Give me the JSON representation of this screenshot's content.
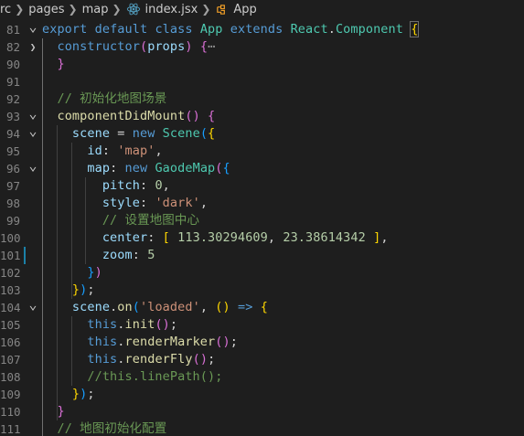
{
  "breadcrumb": {
    "items": [
      {
        "label": "rc"
      },
      {
        "label": "pages"
      },
      {
        "label": "map"
      },
      {
        "label": "index.jsx",
        "icon": "react-icon"
      },
      {
        "label": "App",
        "icon": "class-icon"
      }
    ]
  },
  "colors": {
    "background": "#1e1e1e",
    "keyword": "#569cd6",
    "class": "#4ec9b0",
    "function": "#dcdcaa",
    "variable": "#9cdcfe",
    "string": "#ce9178",
    "number": "#b5cea8",
    "comment": "#6a9955",
    "modified_bar": "#1b81a8"
  },
  "lines": [
    {
      "n": "81",
      "fold": "chevron-down",
      "tokens": [
        [
          "kw",
          "export"
        ],
        [
          "punc",
          " "
        ],
        [
          "kw",
          "default"
        ],
        [
          "punc",
          " "
        ],
        [
          "kw",
          "class"
        ],
        [
          "punc",
          " "
        ],
        [
          "cls",
          "App"
        ],
        [
          "punc",
          " "
        ],
        [
          "kw",
          "extends"
        ],
        [
          "punc",
          " "
        ],
        [
          "cls",
          "React"
        ],
        [
          "punc",
          "."
        ],
        [
          "cls",
          "Component"
        ],
        [
          "punc",
          " "
        ],
        [
          "b1box",
          "{"
        ]
      ]
    },
    {
      "n": "82",
      "fold": "chevron-right",
      "tokens": [
        [
          "punc",
          "  "
        ],
        [
          "kw",
          "constructor"
        ],
        [
          "b2",
          "("
        ],
        [
          "var",
          "props"
        ],
        [
          "b2",
          ")"
        ],
        [
          "punc",
          " "
        ],
        [
          "b2",
          "{"
        ],
        [
          "ell",
          "⋯"
        ]
      ]
    },
    {
      "n": "90",
      "fold": "",
      "tokens": [
        [
          "punc",
          "  "
        ],
        [
          "b2",
          "}"
        ]
      ]
    },
    {
      "n": "91",
      "fold": "",
      "tokens": []
    },
    {
      "n": "92",
      "fold": "",
      "tokens": [
        [
          "punc",
          "  "
        ],
        [
          "cmt",
          "// 初始化地图场景"
        ]
      ]
    },
    {
      "n": "93",
      "fold": "chevron-down",
      "tokens": [
        [
          "punc",
          "  "
        ],
        [
          "fn",
          "componentDidMount"
        ],
        [
          "b2",
          "()"
        ],
        [
          "punc",
          " "
        ],
        [
          "b2",
          "{"
        ]
      ]
    },
    {
      "n": "94",
      "fold": "chevron-down",
      "tokens": [
        [
          "punc",
          "    "
        ],
        [
          "var",
          "scene"
        ],
        [
          "punc",
          " = "
        ],
        [
          "kw",
          "new"
        ],
        [
          "punc",
          " "
        ],
        [
          "cls",
          "Scene"
        ],
        [
          "b3",
          "("
        ],
        [
          "b1",
          "{"
        ]
      ]
    },
    {
      "n": "95",
      "fold": "",
      "tokens": [
        [
          "punc",
          "      "
        ],
        [
          "var",
          "id"
        ],
        [
          "punc",
          ": "
        ],
        [
          "str",
          "'map'"
        ],
        [
          "punc",
          ","
        ]
      ]
    },
    {
      "n": "96",
      "fold": "chevron-down",
      "tokens": [
        [
          "punc",
          "      "
        ],
        [
          "var",
          "map"
        ],
        [
          "punc",
          ": "
        ],
        [
          "kw",
          "new"
        ],
        [
          "punc",
          " "
        ],
        [
          "cls",
          "GaodeMap"
        ],
        [
          "b2",
          "("
        ],
        [
          "b3",
          "{"
        ]
      ]
    },
    {
      "n": "97",
      "fold": "",
      "tokens": [
        [
          "punc",
          "        "
        ],
        [
          "var",
          "pitch"
        ],
        [
          "punc",
          ": "
        ],
        [
          "num",
          "0"
        ],
        [
          "punc",
          ","
        ]
      ]
    },
    {
      "n": "98",
      "fold": "",
      "tokens": [
        [
          "punc",
          "        "
        ],
        [
          "var",
          "style"
        ],
        [
          "punc",
          ": "
        ],
        [
          "str",
          "'dark'"
        ],
        [
          "punc",
          ","
        ]
      ]
    },
    {
      "n": "99",
      "fold": "",
      "tokens": [
        [
          "punc",
          "        "
        ],
        [
          "cmt",
          "// 设置地图中心"
        ]
      ]
    },
    {
      "n": "100",
      "fold": "",
      "tokens": [
        [
          "punc",
          "        "
        ],
        [
          "var",
          "center"
        ],
        [
          "punc",
          ": "
        ],
        [
          "b1",
          "["
        ],
        [
          "punc",
          " "
        ],
        [
          "num",
          "113.30294609"
        ],
        [
          "punc",
          ", "
        ],
        [
          "num",
          "23.38614342"
        ],
        [
          "punc",
          " "
        ],
        [
          "b1",
          "]"
        ],
        [
          "punc",
          ","
        ]
      ]
    },
    {
      "n": "101",
      "fold": "",
      "tokens": [
        [
          "punc",
          "        "
        ],
        [
          "var",
          "zoom"
        ],
        [
          "punc",
          ": "
        ],
        [
          "num",
          "5"
        ]
      ]
    },
    {
      "n": "102",
      "fold": "",
      "tokens": [
        [
          "punc",
          "      "
        ],
        [
          "b3",
          "}"
        ],
        [
          "b2",
          ")"
        ]
      ]
    },
    {
      "n": "103",
      "fold": "",
      "tokens": [
        [
          "punc",
          "    "
        ],
        [
          "b1",
          "}"
        ],
        [
          "b3",
          ")"
        ],
        [
          "punc",
          ";"
        ]
      ]
    },
    {
      "n": "104",
      "fold": "chevron-down",
      "tokens": [
        [
          "punc",
          "    "
        ],
        [
          "var",
          "scene"
        ],
        [
          "punc",
          "."
        ],
        [
          "fn",
          "on"
        ],
        [
          "b3",
          "("
        ],
        [
          "str",
          "'loaded'"
        ],
        [
          "punc",
          ", "
        ],
        [
          "b1",
          "()"
        ],
        [
          "punc",
          " "
        ],
        [
          "kw",
          "=>"
        ],
        [
          "punc",
          " "
        ],
        [
          "b1",
          "{"
        ]
      ]
    },
    {
      "n": "105",
      "fold": "",
      "tokens": [
        [
          "punc",
          "      "
        ],
        [
          "this",
          "this"
        ],
        [
          "punc",
          "."
        ],
        [
          "fn",
          "init"
        ],
        [
          "b2",
          "()"
        ],
        [
          "punc",
          ";"
        ]
      ]
    },
    {
      "n": "106",
      "fold": "",
      "tokens": [
        [
          "punc",
          "      "
        ],
        [
          "this",
          "this"
        ],
        [
          "punc",
          "."
        ],
        [
          "fn",
          "renderMarker"
        ],
        [
          "b2",
          "()"
        ],
        [
          "punc",
          ";"
        ]
      ]
    },
    {
      "n": "107",
      "fold": "",
      "tokens": [
        [
          "punc",
          "      "
        ],
        [
          "this",
          "this"
        ],
        [
          "punc",
          "."
        ],
        [
          "fn",
          "renderFly"
        ],
        [
          "b2",
          "()"
        ],
        [
          "punc",
          ";"
        ]
      ]
    },
    {
      "n": "108",
      "fold": "",
      "tokens": [
        [
          "punc",
          "      "
        ],
        [
          "cmt",
          "//this.linePath();"
        ]
      ]
    },
    {
      "n": "109",
      "fold": "",
      "tokens": [
        [
          "punc",
          "    "
        ],
        [
          "b1",
          "}"
        ],
        [
          "b3",
          ")"
        ],
        [
          "punc",
          ";"
        ]
      ]
    },
    {
      "n": "110",
      "fold": "",
      "tokens": [
        [
          "punc",
          "  "
        ],
        [
          "b2",
          "}"
        ]
      ]
    },
    {
      "n": "111",
      "fold": "",
      "tokens": [
        [
          "punc",
          "  "
        ],
        [
          "cmt",
          "// 地图初始化配置"
        ]
      ]
    }
  ]
}
